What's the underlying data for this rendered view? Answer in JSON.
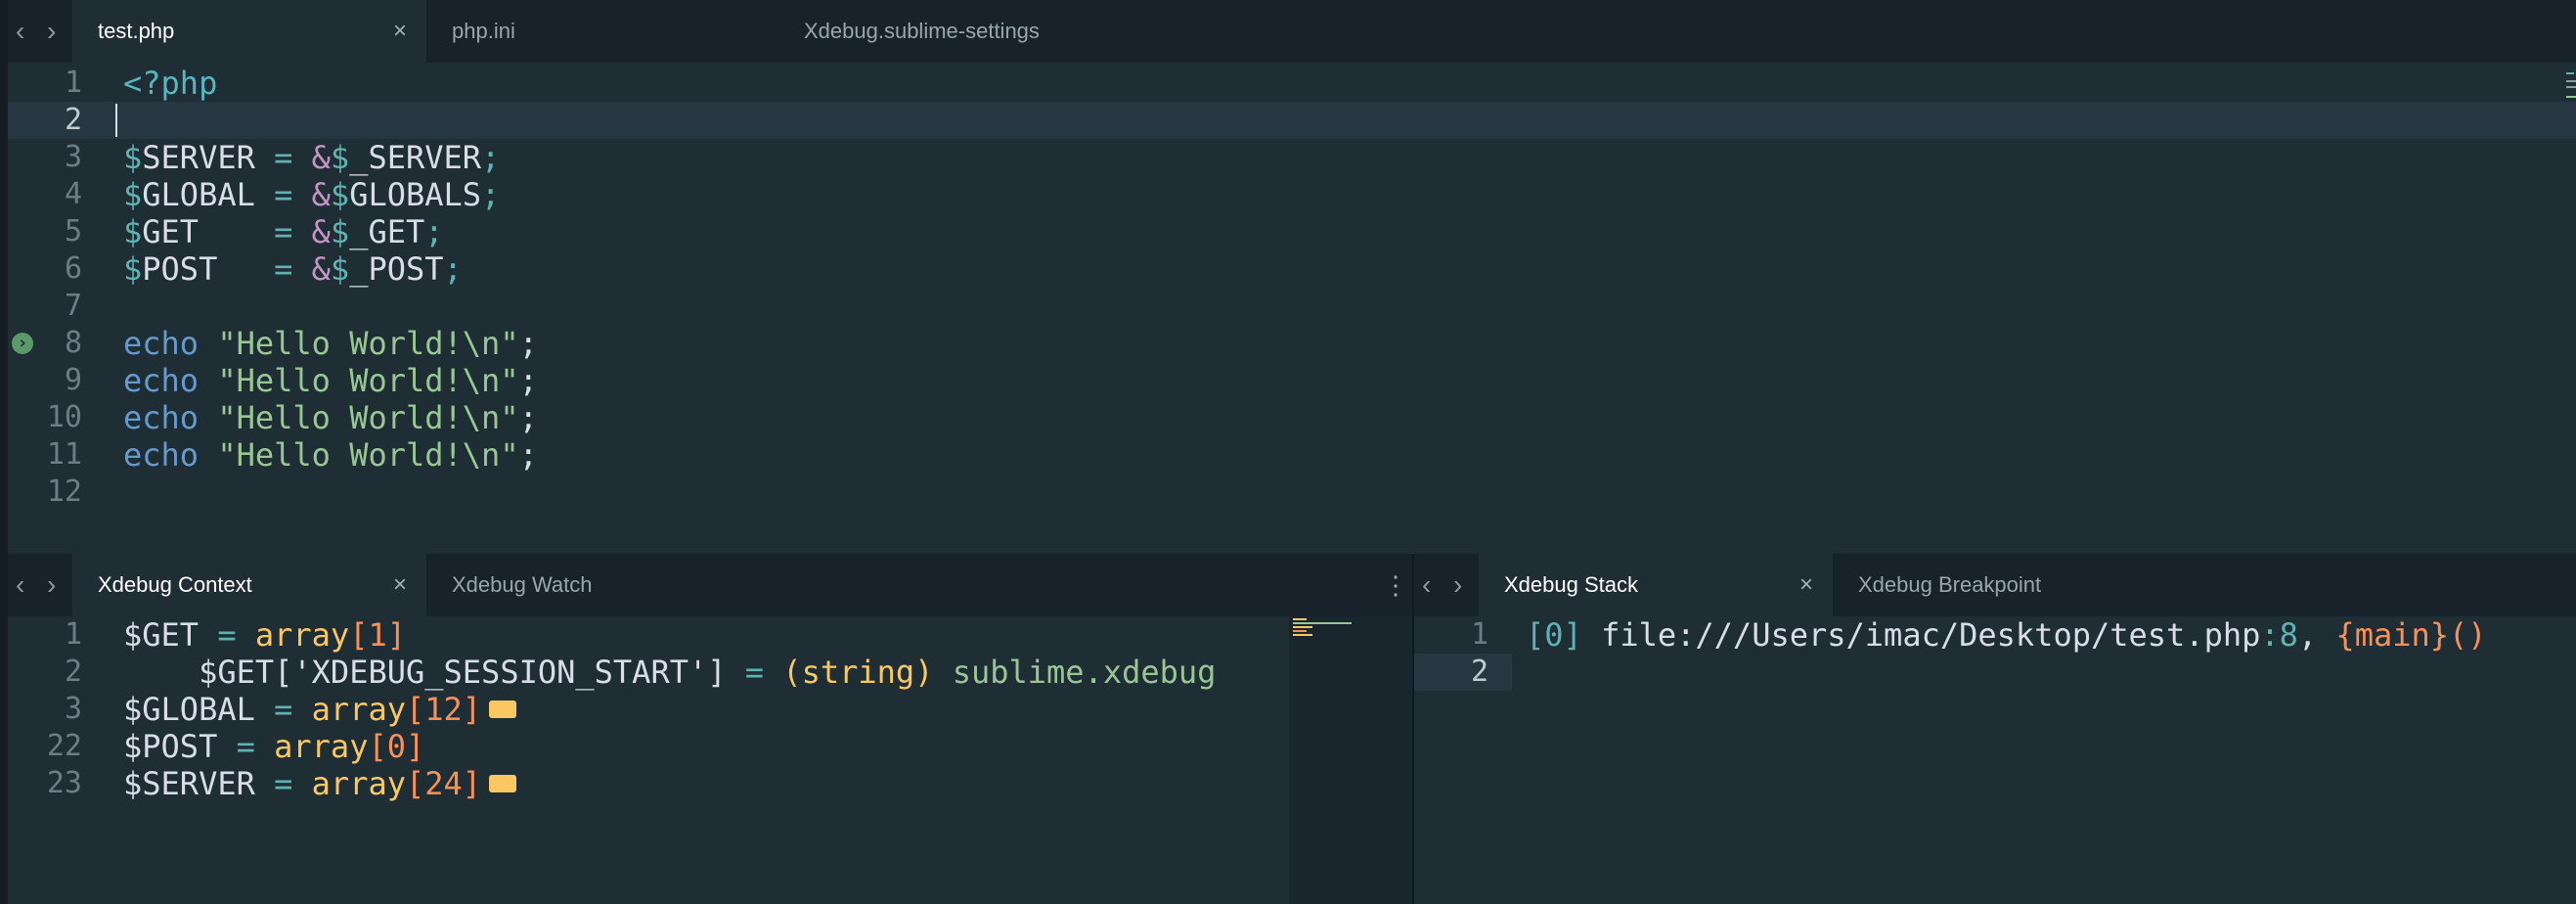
{
  "editor": {
    "tabs": [
      {
        "label": "test.php",
        "active": true
      },
      {
        "label": "php.ini",
        "active": false
      },
      {
        "label": "Xdebug.sublime-settings",
        "active": false
      }
    ],
    "lines": [
      {
        "n": "1"
      },
      {
        "n": "2"
      },
      {
        "n": "3"
      },
      {
        "n": "4"
      },
      {
        "n": "5"
      },
      {
        "n": "6"
      },
      {
        "n": "7"
      },
      {
        "n": "8"
      },
      {
        "n": "9"
      },
      {
        "n": "10"
      },
      {
        "n": "11"
      },
      {
        "n": "12"
      }
    ],
    "code": {
      "l1": "<?php",
      "l3_var": "SERVER",
      "l3_rhs": "_SERVER",
      "l4_var": "GLOBAL",
      "l4_rhs": "GLOBALS",
      "l5_var": "GET",
      "l5_rhs": "_GET",
      "l6_var": "POST",
      "l6_rhs": "_POST",
      "echo": "echo",
      "hello": "\"Hello World!\\n\""
    },
    "breakpoint_line": "8"
  },
  "context_panel": {
    "tabs": [
      {
        "label": "Xdebug Context",
        "active": true
      },
      {
        "label": "Xdebug Watch",
        "active": false
      }
    ],
    "lines": [
      {
        "n": "1",
        "var": "$GET",
        "eq": " = ",
        "type": "array",
        "count": "[1]",
        "more": false
      },
      {
        "n": "2",
        "var": "    $GET['XDEBUG_SESSION_START']",
        "eq": " = ",
        "type": "(string)",
        "count": " sublime.xdebug",
        "more": false
      },
      {
        "n": "3",
        "var": "$GLOBAL",
        "eq": " = ",
        "type": "array",
        "count": "[12]",
        "more": true
      },
      {
        "n": "22",
        "var": "$POST",
        "eq": " = ",
        "type": "array",
        "count": "[0]",
        "more": false
      },
      {
        "n": "23",
        "var": "$SERVER",
        "eq": " = ",
        "type": "array",
        "count": "[24]",
        "more": true
      }
    ]
  },
  "stack_panel": {
    "tabs": [
      {
        "label": "Xdebug Stack",
        "active": true
      },
      {
        "label": "Xdebug Breakpoint",
        "active": false
      }
    ],
    "lines": [
      {
        "n": "1",
        "index": "[0]",
        "path": " file:///Users/imac/Desktop/test.php",
        "lineno": ":8",
        "sep": ", ",
        "func": "{main}()"
      },
      {
        "n": "2"
      }
    ]
  },
  "icons": {
    "back": "chevron-left-icon",
    "forward": "chevron-right-icon",
    "close": "close-icon",
    "menu": "vertical-ellipsis-icon",
    "breakpoint": "breakpoint-arrow-icon"
  },
  "colors": {
    "background": "#1f2d35",
    "tabbar": "#17222a",
    "string": "#99c794",
    "keyword": "#6699cc",
    "number": "#f99157",
    "type": "#fac863",
    "breakpoint": "#5b9a68"
  }
}
